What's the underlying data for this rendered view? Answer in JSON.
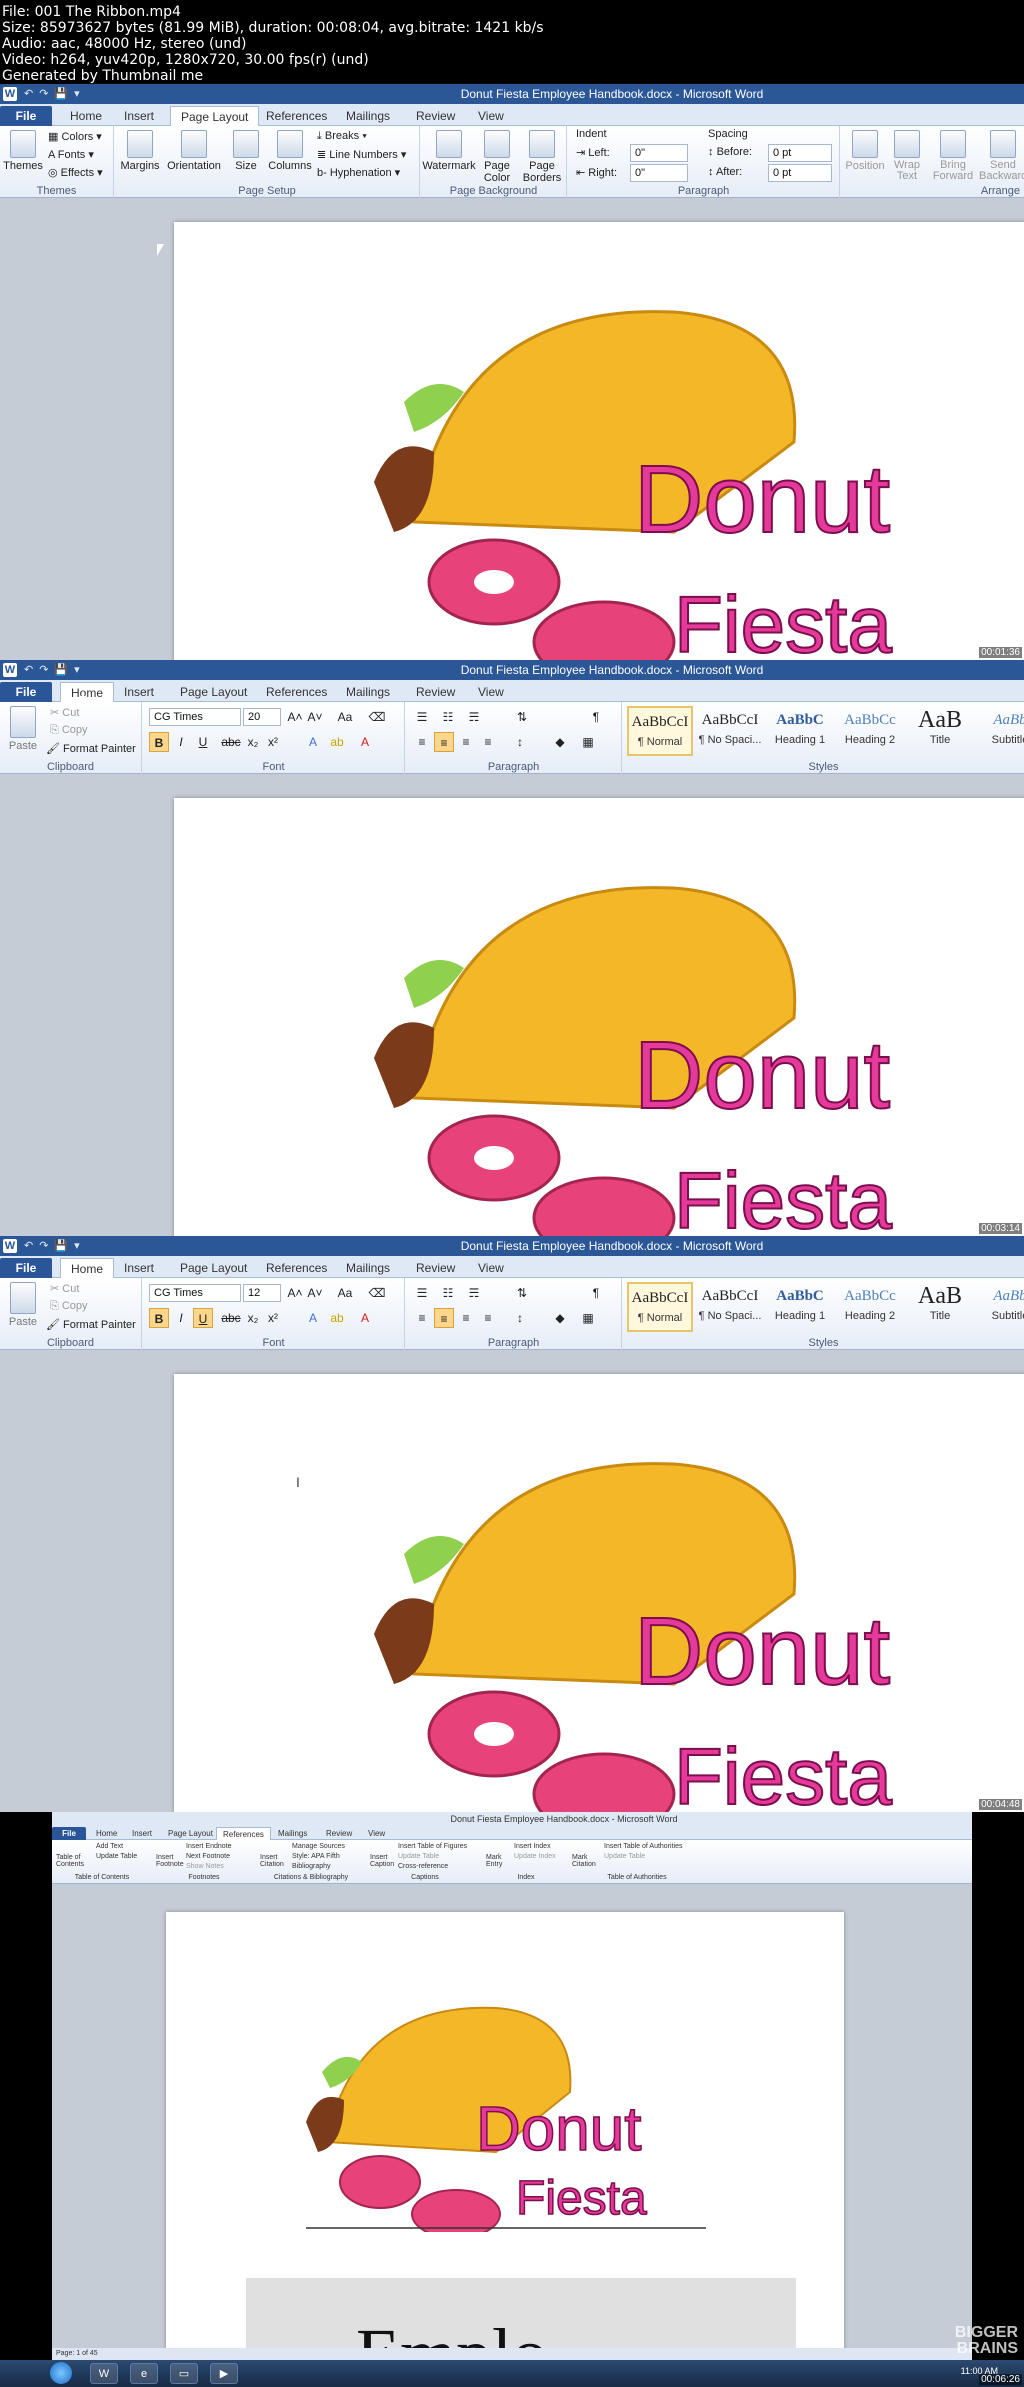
{
  "meta": {
    "lines": [
      "File: 001 The Ribbon.mp4",
      "Size: 85973627 bytes (81.99 MiB), duration: 00:08:04, avg.bitrate: 1421 kb/s",
      "Audio: aac, 48000 Hz, stereo (und)",
      "Video: h264, yuv420p, 1280x720, 30.00 fps(r) (und)",
      "Generated by Thumbnail me"
    ]
  },
  "window_title": "Donut Fiesta Employee Handbook.docx - Microsoft Word",
  "tabs": [
    "File",
    "Home",
    "Insert",
    "Page Layout",
    "References",
    "Mailings",
    "Review",
    "View"
  ],
  "logo": {
    "word1": "Donut",
    "word2": "Fiesta"
  },
  "watermark": {
    "line1": "BIGGER",
    "line2": "BRAINS"
  },
  "colors": {
    "file_tab": "#2a5599",
    "title_bar": "#2b5797",
    "logo_pink": "#e5399b"
  },
  "frame1": {
    "timestamp": "00:01:36",
    "groups": {
      "themes": "Themes",
      "page_setup": "Page Setup",
      "page_background": "Page Background",
      "paragraph": "Paragraph",
      "arrange": "Arrange"
    },
    "buttons": {
      "themes": "Themes",
      "colors": "Colors",
      "fonts": "Fonts",
      "effects": "Effects",
      "margins": "Margins",
      "orientation": "Orientation",
      "size": "Size",
      "columns": "Columns",
      "breaks": "Breaks",
      "line_numbers": "Line Numbers",
      "hyphenation": "Hyphenation",
      "watermark": "Watermark",
      "page_color": "Page Color",
      "page_borders": "Page Borders",
      "indent": "Indent",
      "left": "Left:",
      "right": "Right:",
      "left_val": "0\"",
      "right_val": "0\"",
      "spacing": "Spacing",
      "before": "Before:",
      "after": "After:",
      "before_val": "0 pt",
      "after_val": "0 pt",
      "position": "Position",
      "wrap_text": "Wrap Text",
      "bring_forward": "Bring Forward",
      "send_backward": "Send Backward"
    }
  },
  "home": {
    "groups": {
      "clipboard": "Clipboard",
      "font": "Font",
      "paragraph": "Paragraph",
      "styles": "Styles"
    },
    "paste": "Paste",
    "cut": "Cut",
    "copy": "Copy",
    "format_painter": "Format Painter",
    "font_name": "CG Times",
    "styles": [
      {
        "sample": "AaBbCcI",
        "name": "¶ Normal"
      },
      {
        "sample": "AaBbCcI",
        "name": "¶ No Spaci..."
      },
      {
        "sample": "AaBbC",
        "name": "Heading 1"
      },
      {
        "sample": "AaBbCc",
        "name": "Heading 2"
      },
      {
        "sample": "AaB",
        "name": "Title"
      },
      {
        "sample": "AaBb",
        "name": "Subtitle"
      }
    ]
  },
  "frame2": {
    "timestamp": "00:03:14",
    "font_size": "20"
  },
  "frame3": {
    "timestamp": "00:04:48",
    "font_size": "12"
  },
  "frame4": {
    "timestamp": "00:06:26",
    "ref_items": {
      "toc": "Table of Contents",
      "add_text": "Add Text",
      "update_table": "Update Table",
      "insert_footnote": "Insert Footnote",
      "insert_endnote": "Insert Endnote",
      "next_footnote": "Next Footnote",
      "show_notes": "Show Notes",
      "insert_citation": "Insert Citation",
      "manage_sources": "Manage Sources",
      "style": "Style: APA Fifth",
      "bibliography": "Bibliography",
      "insert_caption": "Insert Caption",
      "insert_tof": "Insert Table of Figures",
      "update_table2": "Update Table",
      "cross_ref": "Cross-reference",
      "mark_entry": "Mark Entry",
      "insert_index": "Insert Index",
      "update_index": "Update Index",
      "mark_citation": "Mark Citation",
      "insert_toa": "Insert Table of Authorities",
      "update_table3": "Update Table"
    },
    "groups": {
      "toc": "Table of Contents",
      "footnotes": "Footnotes",
      "citations": "Citations & Bibliography",
      "captions": "Captions",
      "index": "Index",
      "toa": "Table of Authorities"
    },
    "status": "Page: 1 of 45",
    "big_text": "Emplo",
    "clock": "11:00 AM"
  }
}
